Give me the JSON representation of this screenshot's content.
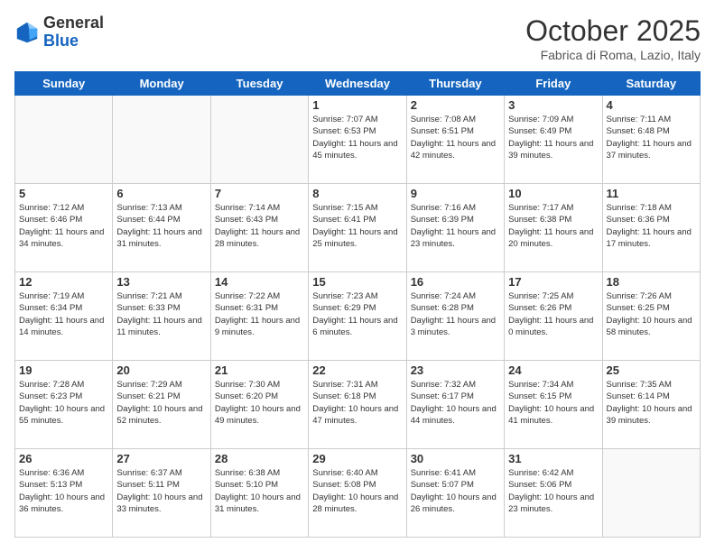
{
  "header": {
    "logo_general": "General",
    "logo_blue": "Blue",
    "month_title": "October 2025",
    "subtitle": "Fabrica di Roma, Lazio, Italy"
  },
  "weekdays": [
    "Sunday",
    "Monday",
    "Tuesday",
    "Wednesday",
    "Thursday",
    "Friday",
    "Saturday"
  ],
  "weeks": [
    [
      {
        "day": "",
        "info": ""
      },
      {
        "day": "",
        "info": ""
      },
      {
        "day": "",
        "info": ""
      },
      {
        "day": "1",
        "info": "Sunrise: 7:07 AM\nSunset: 6:53 PM\nDaylight: 11 hours and 45 minutes."
      },
      {
        "day": "2",
        "info": "Sunrise: 7:08 AM\nSunset: 6:51 PM\nDaylight: 11 hours and 42 minutes."
      },
      {
        "day": "3",
        "info": "Sunrise: 7:09 AM\nSunset: 6:49 PM\nDaylight: 11 hours and 39 minutes."
      },
      {
        "day": "4",
        "info": "Sunrise: 7:11 AM\nSunset: 6:48 PM\nDaylight: 11 hours and 37 minutes."
      }
    ],
    [
      {
        "day": "5",
        "info": "Sunrise: 7:12 AM\nSunset: 6:46 PM\nDaylight: 11 hours and 34 minutes."
      },
      {
        "day": "6",
        "info": "Sunrise: 7:13 AM\nSunset: 6:44 PM\nDaylight: 11 hours and 31 minutes."
      },
      {
        "day": "7",
        "info": "Sunrise: 7:14 AM\nSunset: 6:43 PM\nDaylight: 11 hours and 28 minutes."
      },
      {
        "day": "8",
        "info": "Sunrise: 7:15 AM\nSunset: 6:41 PM\nDaylight: 11 hours and 25 minutes."
      },
      {
        "day": "9",
        "info": "Sunrise: 7:16 AM\nSunset: 6:39 PM\nDaylight: 11 hours and 23 minutes."
      },
      {
        "day": "10",
        "info": "Sunrise: 7:17 AM\nSunset: 6:38 PM\nDaylight: 11 hours and 20 minutes."
      },
      {
        "day": "11",
        "info": "Sunrise: 7:18 AM\nSunset: 6:36 PM\nDaylight: 11 hours and 17 minutes."
      }
    ],
    [
      {
        "day": "12",
        "info": "Sunrise: 7:19 AM\nSunset: 6:34 PM\nDaylight: 11 hours and 14 minutes."
      },
      {
        "day": "13",
        "info": "Sunrise: 7:21 AM\nSunset: 6:33 PM\nDaylight: 11 hours and 11 minutes."
      },
      {
        "day": "14",
        "info": "Sunrise: 7:22 AM\nSunset: 6:31 PM\nDaylight: 11 hours and 9 minutes."
      },
      {
        "day": "15",
        "info": "Sunrise: 7:23 AM\nSunset: 6:29 PM\nDaylight: 11 hours and 6 minutes."
      },
      {
        "day": "16",
        "info": "Sunrise: 7:24 AM\nSunset: 6:28 PM\nDaylight: 11 hours and 3 minutes."
      },
      {
        "day": "17",
        "info": "Sunrise: 7:25 AM\nSunset: 6:26 PM\nDaylight: 11 hours and 0 minutes."
      },
      {
        "day": "18",
        "info": "Sunrise: 7:26 AM\nSunset: 6:25 PM\nDaylight: 10 hours and 58 minutes."
      }
    ],
    [
      {
        "day": "19",
        "info": "Sunrise: 7:28 AM\nSunset: 6:23 PM\nDaylight: 10 hours and 55 minutes."
      },
      {
        "day": "20",
        "info": "Sunrise: 7:29 AM\nSunset: 6:21 PM\nDaylight: 10 hours and 52 minutes."
      },
      {
        "day": "21",
        "info": "Sunrise: 7:30 AM\nSunset: 6:20 PM\nDaylight: 10 hours and 49 minutes."
      },
      {
        "day": "22",
        "info": "Sunrise: 7:31 AM\nSunset: 6:18 PM\nDaylight: 10 hours and 47 minutes."
      },
      {
        "day": "23",
        "info": "Sunrise: 7:32 AM\nSunset: 6:17 PM\nDaylight: 10 hours and 44 minutes."
      },
      {
        "day": "24",
        "info": "Sunrise: 7:34 AM\nSunset: 6:15 PM\nDaylight: 10 hours and 41 minutes."
      },
      {
        "day": "25",
        "info": "Sunrise: 7:35 AM\nSunset: 6:14 PM\nDaylight: 10 hours and 39 minutes."
      }
    ],
    [
      {
        "day": "26",
        "info": "Sunrise: 6:36 AM\nSunset: 5:13 PM\nDaylight: 10 hours and 36 minutes."
      },
      {
        "day": "27",
        "info": "Sunrise: 6:37 AM\nSunset: 5:11 PM\nDaylight: 10 hours and 33 minutes."
      },
      {
        "day": "28",
        "info": "Sunrise: 6:38 AM\nSunset: 5:10 PM\nDaylight: 10 hours and 31 minutes."
      },
      {
        "day": "29",
        "info": "Sunrise: 6:40 AM\nSunset: 5:08 PM\nDaylight: 10 hours and 28 minutes."
      },
      {
        "day": "30",
        "info": "Sunrise: 6:41 AM\nSunset: 5:07 PM\nDaylight: 10 hours and 26 minutes."
      },
      {
        "day": "31",
        "info": "Sunrise: 6:42 AM\nSunset: 5:06 PM\nDaylight: 10 hours and 23 minutes."
      },
      {
        "day": "",
        "info": ""
      }
    ]
  ]
}
